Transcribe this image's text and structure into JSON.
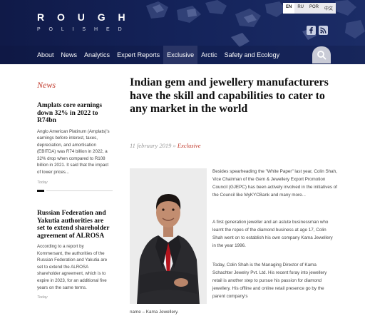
{
  "brand": {
    "name_top": "R O U G H",
    "name_bottom": "P O L I S H E D"
  },
  "languages": [
    "EN",
    "RU",
    "POR",
    "中文"
  ],
  "active_language": "EN",
  "social": [
    "facebook-icon",
    "rss-icon"
  ],
  "nav": {
    "items": [
      {
        "label": "About"
      },
      {
        "label": "News"
      },
      {
        "label": "Analytics"
      },
      {
        "label": "Expert Reports"
      },
      {
        "label": "Exclusive"
      },
      {
        "label": "Arctic"
      },
      {
        "label": "Safety and Ecology"
      }
    ],
    "active": "Exclusive"
  },
  "sidebar": {
    "heading": "News",
    "articles": [
      {
        "title": "Amplats core earnings down 32% in 2022 to R74bn",
        "body": "Anglo American Platinum (Amplats)'s earnings before interest, taxes, depreciation, and amortisation (EBITDA) was R74 billion in 2022, a 32% drop when compared to R108 billion in 2021. It said that the impact of lower prices...",
        "date": "Today"
      },
      {
        "title": "Russian Federation and Yakutia authorities are set to extend shareholder agreement of ALROSA",
        "body": "According to a report by Kommersant, the authorities of the Russian Federation and Yakutia are set to extend the ALROSA shareholder agreement, which is to expire in 2023, for an additional five years on the same terms.",
        "date": "Today"
      }
    ]
  },
  "article": {
    "title": "Indian gem and jewellery manufacturers have the skill and capabilities to cater to any market in the world",
    "date": "11 february 2019",
    "separator": "»",
    "category": "Exclusive",
    "paragraphs": [
      "Besides spearheading the \"White Paper\" last year, Colin Shah, Vice Chairman of the Gem & Jewellery Export Promotion Council (GJEPC) has been actively involved in the initiatives of the Council like MyKYCBank and many more...",
      "A first generation jeweller and an astute businessman who learnt the ropes of the diamond business at age 17, Colin Shah went on to establish his own company Kama Jewellery in the year 1996.",
      "Today, Colin Shah is the Managing Director of Kama Schachter Jewelry Pvt. Ltd. His recent foray into jewellery retail is another step to pursue his passion for diamond jewellery. His offline and online retail presence go by the parent company's",
      "name – Kama Jewellery."
    ]
  },
  "colors": {
    "header_bg": "#0f1a4a",
    "accent_red": "#c0392b",
    "nav_active": "#2a3566"
  }
}
